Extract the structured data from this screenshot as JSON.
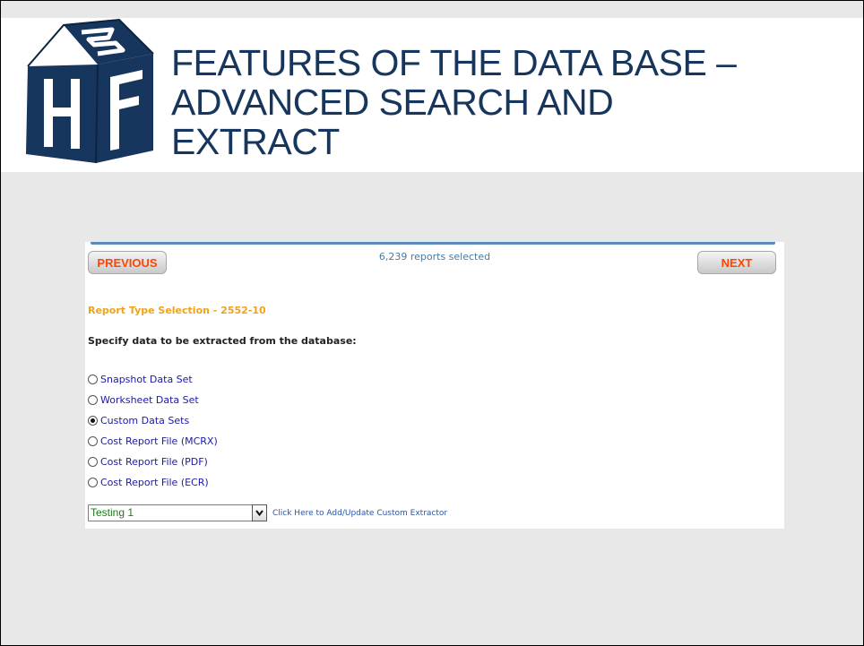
{
  "slide": {
    "title_lines": [
      "FEATURES OF THE DATA BASE –",
      "ADVANCED SEARCH AND",
      "EXTRACT"
    ]
  },
  "app": {
    "prev_label": "PREVIOUS",
    "next_label": "NEXT",
    "status": "6,239 reports selected",
    "section_title": "Report Type Selection - 2552-10",
    "instruction": "Specify data to be extracted from the database:",
    "options": [
      {
        "label": "Snapshot Data Set",
        "checked": false
      },
      {
        "label": "Worksheet Data Set",
        "checked": false
      },
      {
        "label": "Custom Data Sets",
        "checked": true
      },
      {
        "label": "Cost Report File (MCRX)",
        "checked": false
      },
      {
        "label": "Cost Report File (PDF)",
        "checked": false
      },
      {
        "label": "Cost Report File (ECR)",
        "checked": false
      }
    ],
    "select_value": "Testing 1",
    "link_text": "Click Here to Add/Update Custom Extractor"
  },
  "colors": {
    "title": "#17365d",
    "logo": "#17365d",
    "nav_text": "#ff4500",
    "section_title": "#f0a318",
    "option_text": "#1a1aa6",
    "link": "#2a56a6",
    "select_text": "#1a7a1a"
  },
  "icons": {
    "logo": "hfp-cube-logo",
    "dropdown": "chevron-down-icon"
  }
}
